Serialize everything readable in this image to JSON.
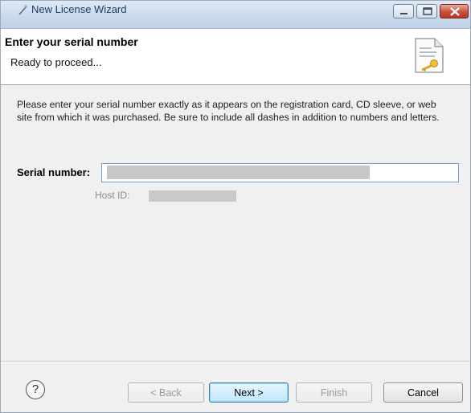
{
  "window": {
    "title": "New License Wizard"
  },
  "header": {
    "title": "Enter your serial number",
    "subtitle": "Ready to proceed..."
  },
  "body": {
    "instructions": "Please enter your serial number exactly as it appears on the registration card, CD sleeve, or web site from which it was purchased. Be sure to include all dashes in addition to numbers and letters.",
    "serial_label": "Serial number:",
    "serial_value": "",
    "hostid_label": "Host ID:"
  },
  "footer": {
    "help_icon": "?",
    "back_label": "< Back",
    "next_label": "Next >",
    "finish_label": "Finish",
    "cancel_label": "Cancel"
  },
  "icons": {
    "app": "wand-icon",
    "header": "document-key-icon",
    "minimize": "minimize-icon",
    "maximize": "maximize-icon",
    "close": "close-icon",
    "help": "help-icon"
  },
  "colors": {
    "close_button": "#c9503a",
    "default_button": "#bee6fd",
    "input_border": "#7a9cc8"
  }
}
